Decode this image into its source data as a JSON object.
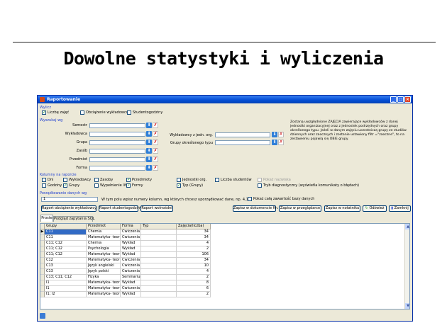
{
  "slide": {
    "title": "Dowolne statystyki i wyliczenia"
  },
  "window": {
    "title": "Raportowanie",
    "min": "_",
    "max": "□",
    "close": "×"
  },
  "wylicz": {
    "label": "Wylicz",
    "options": [
      {
        "label": "Liczbę zajęć",
        "checked": true
      },
      {
        "label": "Obciążenie wykładowców",
        "checked": false
      },
      {
        "label": "Studentogodziny",
        "checked": false
      }
    ]
  },
  "wyszukaj": {
    "label": "Wyszukaj wg",
    "fields": [
      "Semestr",
      "Wykładowca",
      "Grupa",
      "Zasób",
      "Przedmiot",
      "Forma"
    ],
    "right_fields": [
      "Wykładowcy z jedn. org.",
      "Grupy określonego typu"
    ],
    "info": "Zostaną uwzględnione ZAJĘCIA zawierające wykładowców z danej jednostki organizacyjnej oraz z jednostek podrzędnych oraz grupy określonego typu. Jeżeli w danym zajęciu uczestniczą grupy ze studiów dziennych oraz zaocznych i zostanie ustawiony filtr =\"zaoczne\", to na zestawieniu pojawią się OBIE grupy."
  },
  "kolumny": {
    "label": "Kolumny na raporcie",
    "items": [
      {
        "label": "Dni",
        "checked": false
      },
      {
        "label": "Godziny",
        "checked": false
      },
      {
        "label": "Wykładowcy",
        "checked": false
      },
      {
        "label": "Grupy",
        "checked": true
      },
      {
        "label": "Zasoby",
        "checked": false
      },
      {
        "label": "Wypełnienie lif.",
        "checked": false
      },
      {
        "label": "Przedmioty",
        "checked": true
      },
      {
        "label": "Formy",
        "checked": true
      },
      {
        "label": "Jednostki org.",
        "checked": false
      },
      {
        "label": "Typ (Grupy)",
        "checked": true
      },
      {
        "label": "Liczba studentów",
        "checked": false
      }
    ],
    "pokaz_nazwiska": "Pokaż nazwiska",
    "tryb": "Tryb diagnostyczny (wyświetla komunikaty o błędach)"
  },
  "porzadkowanie": {
    "label": "Porządkowanie danych wg",
    "value": "1",
    "hint": "W tym polu wpisz numery kolumn, wg których chcesz uporządkować dane, np. 4,1,2",
    "pokaz": "Pokaż całą zawartość bazy danych"
  },
  "buttons": {
    "raport_obc": "Raport obciążenie wykładowcy",
    "raport_stud": "Raport studentogodziny",
    "raport_wol": "Raport wolnośdni",
    "zapisz_dok": "Zapisz w dokumencie fin.",
    "zapisz_przegl": "Zapisz w przeglądarce",
    "zapisz_not": "Zapisz w notatniku",
    "odswiez": "Odśwież",
    "zamknij": "Zamknij"
  },
  "tabs": [
    "Proste",
    "Podgląd zapytania SQL"
  ],
  "table": {
    "headers": [
      "Grupy",
      "Przedmiot",
      "Forma",
      "Typ",
      "Zajęcia(liczba)"
    ],
    "rows": [
      [
        "C11",
        "Chemia",
        "Ćwiczenia",
        "",
        "34"
      ],
      [
        "C11",
        "Matematyka- teoria g",
        "Ćwiczenia",
        "",
        "34"
      ],
      [
        "C11; C12",
        "Chemia",
        "Wykład",
        "",
        "4"
      ],
      [
        "C11; C12",
        "Psychologia",
        "Wykład",
        "",
        "2"
      ],
      [
        "C11; C12",
        "Matematyka- teoria g",
        "Wykład",
        "",
        "106"
      ],
      [
        "C12",
        "Matematyka- teoria g",
        "Ćwiczenia",
        "",
        "34"
      ],
      [
        "C13",
        "Język angielski",
        "Ćwiczenia",
        "",
        "10"
      ],
      [
        "C13",
        "Język polski",
        "Ćwiczenia",
        "",
        "4"
      ],
      [
        "C13; C11; C12",
        "Fizyka",
        "Seminarium",
        "",
        "2"
      ],
      [
        "I1",
        "Matematyka- teoria g",
        "Wykład",
        "",
        "8"
      ],
      [
        "I1",
        "Matematyka- teoria g",
        "Ćwiczenia",
        "",
        "6"
      ],
      [
        "I1; I2",
        "Matematyka- teoria g",
        "Wykład",
        "",
        "2"
      ]
    ]
  }
}
